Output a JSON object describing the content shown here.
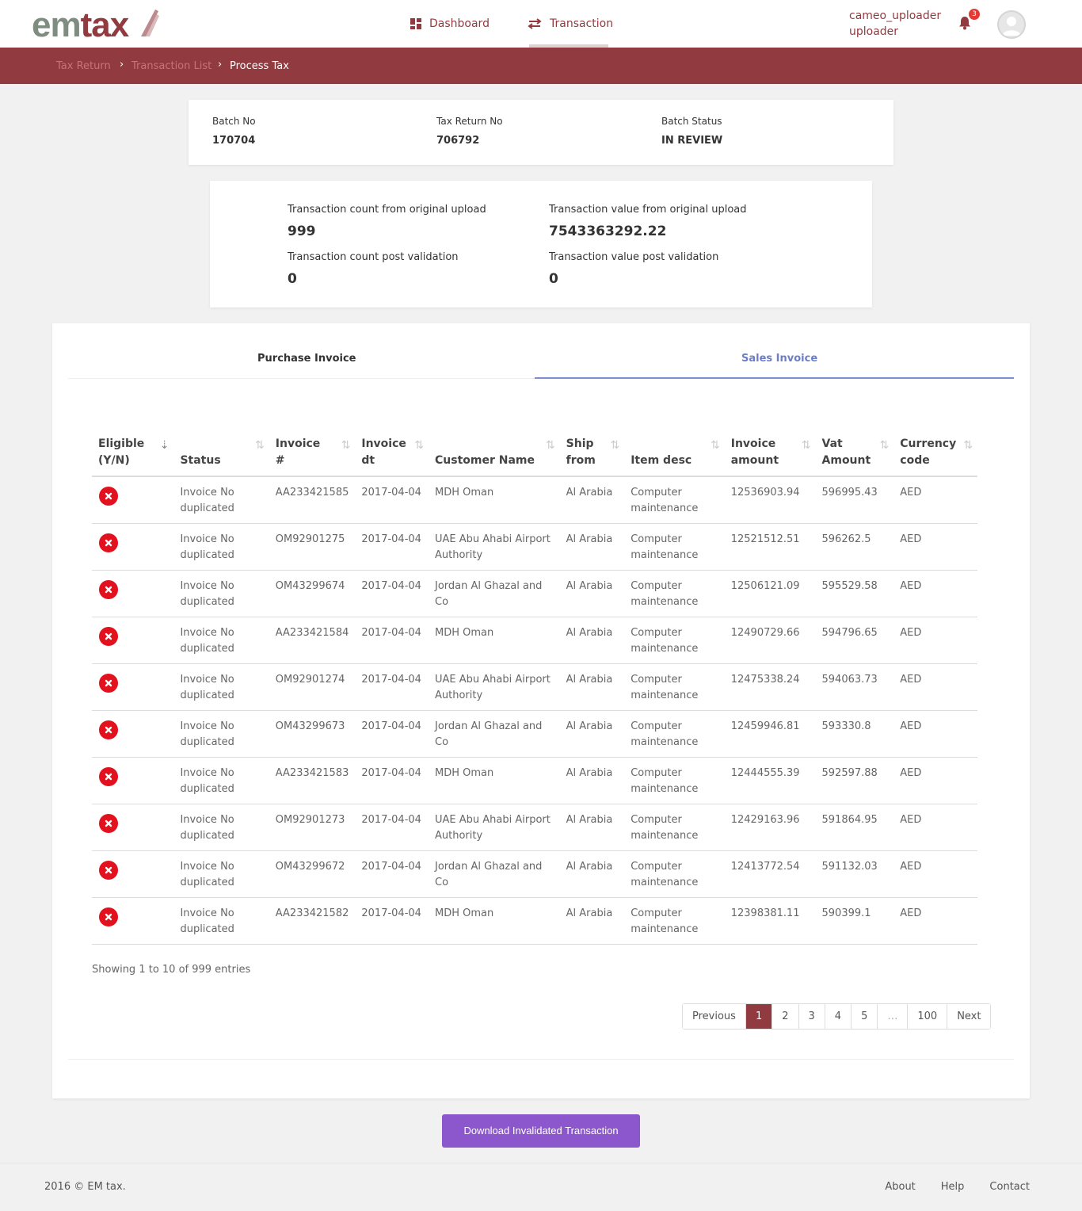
{
  "header": {
    "logo": "emtax",
    "nav": [
      {
        "label": "Dashboard",
        "icon": "dashboard-grid-icon"
      },
      {
        "label": "Transaction",
        "icon": "swap-arrows-icon"
      }
    ],
    "user": {
      "name": "cameo_uploader",
      "role": "uploader",
      "notifications": "3"
    }
  },
  "breadcrumb": [
    "Tax Return",
    "Transaction List",
    "Process Tax"
  ],
  "batch": {
    "no_label": "Batch No",
    "no_value": "170704",
    "return_label": "Tax Return No",
    "return_value": "706792",
    "status_label": "Batch Status",
    "status_value": "IN REVIEW"
  },
  "stats": {
    "count_orig_label": "Transaction count from original upload",
    "count_orig_value": "999",
    "value_orig_label": "Transaction value from original upload",
    "value_orig_value": "7543363292.22",
    "count_post_label": "Transaction count post validation",
    "count_post_value": "0",
    "value_post_label": "Transaction value post validation",
    "value_post_value": "0"
  },
  "tabs": [
    {
      "label": "Purchase Invoice",
      "active": false
    },
    {
      "label": "Sales Invoice",
      "active": true
    }
  ],
  "table": {
    "columns": [
      {
        "line1": "Eligible",
        "line2": "(Y/N)"
      },
      {
        "line1": "",
        "line2": "Status"
      },
      {
        "line1": "Invoice",
        "line2": "#"
      },
      {
        "line1": "Invoice",
        "line2": "dt"
      },
      {
        "line1": "",
        "line2": "Customer Name"
      },
      {
        "line1": "Ship",
        "line2": "from"
      },
      {
        "line1": "",
        "line2": "Item desc"
      },
      {
        "line1": "Invoice",
        "line2": "amount"
      },
      {
        "line1": "Vat",
        "line2": "Amount"
      },
      {
        "line1": "Currency",
        "line2": "code"
      }
    ],
    "rows": [
      {
        "status": "Invoice No duplicated",
        "invoice": "AA233421585",
        "date": "2017-04-04",
        "customer": "MDH Oman",
        "ship": "Al Arabia",
        "item": "Computer maintenance",
        "amount": "12536903.94",
        "vat": "596995.43",
        "currency": "AED"
      },
      {
        "status": "Invoice No duplicated",
        "invoice": "OM92901275",
        "date": "2017-04-04",
        "customer": "UAE Abu Ahabi Airport Authority",
        "ship": "Al Arabia",
        "item": "Computer maintenance",
        "amount": "12521512.51",
        "vat": "596262.5",
        "currency": "AED"
      },
      {
        "status": "Invoice No duplicated",
        "invoice": "OM43299674",
        "date": "2017-04-04",
        "customer": "Jordan Al Ghazal and Co",
        "ship": "Al Arabia",
        "item": "Computer maintenance",
        "amount": "12506121.09",
        "vat": "595529.58",
        "currency": "AED"
      },
      {
        "status": "Invoice No duplicated",
        "invoice": "AA233421584",
        "date": "2017-04-04",
        "customer": "MDH Oman",
        "ship": "Al Arabia",
        "item": "Computer maintenance",
        "amount": "12490729.66",
        "vat": "594796.65",
        "currency": "AED"
      },
      {
        "status": "Invoice No duplicated",
        "invoice": "OM92901274",
        "date": "2017-04-04",
        "customer": "UAE Abu Ahabi Airport Authority",
        "ship": "Al Arabia",
        "item": "Computer maintenance",
        "amount": "12475338.24",
        "vat": "594063.73",
        "currency": "AED"
      },
      {
        "status": "Invoice No duplicated",
        "invoice": "OM43299673",
        "date": "2017-04-04",
        "customer": "Jordan Al Ghazal and Co",
        "ship": "Al Arabia",
        "item": "Computer maintenance",
        "amount": "12459946.81",
        "vat": "593330.8",
        "currency": "AED"
      },
      {
        "status": "Invoice No duplicated",
        "invoice": "AA233421583",
        "date": "2017-04-04",
        "customer": "MDH Oman",
        "ship": "Al Arabia",
        "item": "Computer maintenance",
        "amount": "12444555.39",
        "vat": "592597.88",
        "currency": "AED"
      },
      {
        "status": "Invoice No duplicated",
        "invoice": "OM92901273",
        "date": "2017-04-04",
        "customer": "UAE Abu Ahabi Airport Authority",
        "ship": "Al Arabia",
        "item": "Computer maintenance",
        "amount": "12429163.96",
        "vat": "591864.95",
        "currency": "AED"
      },
      {
        "status": "Invoice No duplicated",
        "invoice": "OM43299672",
        "date": "2017-04-04",
        "customer": "Jordan Al Ghazal and Co",
        "ship": "Al Arabia",
        "item": "Computer maintenance",
        "amount": "12413772.54",
        "vat": "591132.03",
        "currency": "AED"
      },
      {
        "status": "Invoice No duplicated",
        "invoice": "AA233421582",
        "date": "2017-04-04",
        "customer": "MDH Oman",
        "ship": "Al Arabia",
        "item": "Computer maintenance",
        "amount": "12398381.11",
        "vat": "590399.1",
        "currency": "AED"
      }
    ]
  },
  "showing": "Showing 1 to 10 of 999 entries",
  "pagination": [
    "Previous",
    "1",
    "2",
    "3",
    "4",
    "5",
    "…",
    "100",
    "Next"
  ],
  "download_button": "Download Invalidated Transaction",
  "footer": {
    "copyright": "2016 © EM tax.",
    "links": [
      "About",
      "Help",
      "Contact"
    ]
  },
  "colors": {
    "brand": "#913a3f",
    "accent": "#6d7ec8",
    "button": "#8c56cd",
    "error": "#e3101d"
  }
}
